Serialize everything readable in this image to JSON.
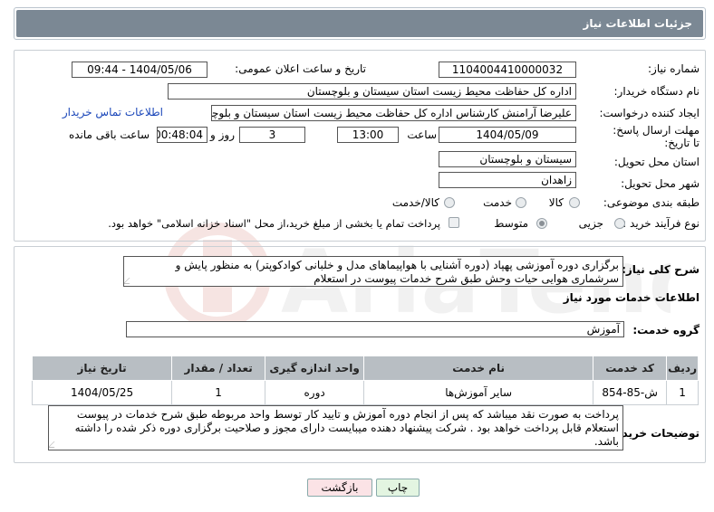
{
  "header": {
    "title": "جزئیات اطلاعات نیاز"
  },
  "fields": {
    "need_number_label": "شماره نیاز:",
    "need_number": "1104004410000032",
    "announce_label": "تاریخ و ساعت اعلان عمومی:",
    "announce_value": "1404/05/06 - 09:44",
    "buyer_org_label": "نام دستگاه خریدار:",
    "buyer_org": "اداره کل حفاظت محیط زیست استان سیستان و بلوچستان",
    "creator_label": "ایجاد کننده درخواست:",
    "creator": "علیرضا آرامنش کارشناس اداره کل حفاظت محیط زیست استان سیستان و بلوچستان",
    "contact_link": "اطلاعات تماس خریدار",
    "deadline_label": "مهلت ارسال پاسخ: تا تاریخ:",
    "deadline_date": "1404/05/09",
    "time_label": "ساعت",
    "deadline_time": "13:00",
    "days_value": "3",
    "days_label": "روز و",
    "remaining_time": "00:48:04",
    "remaining_label": "ساعت باقی مانده",
    "province_label": "استان محل تحویل:",
    "province": "سیستان و بلوچستان",
    "city_label": "شهر محل تحویل:",
    "city": "زاهدان",
    "category_label": "طبقه بندی موضوعی:",
    "category_options": [
      "کالا",
      "خدمت",
      "کالا/خدمت"
    ],
    "process_label": "نوع فرآیند خرید :",
    "process_options": [
      "جزیی",
      "متوسط"
    ],
    "payment_note": "پرداخت تمام یا بخشی از مبلغ خرید،از محل \"اسناد خزانه اسلامی\" خواهد بود."
  },
  "description": {
    "label": "شرح کلی نیاز:",
    "text": "برگزاری دوره آموزشی پهپاد (دوره آشنایی با هواپیماهای مدل و خلبانی کوادکوپتر) به منظور پایش و سرشماری هوایی حیات وحش طبق شرح خدمات پیوست در استعلام"
  },
  "services": {
    "section_title": "اطلاعات خدمات مورد نیاز",
    "group_label": "گروه خدمت:",
    "group_value": "آموزش",
    "columns": [
      "ردیف",
      "کد خدمت",
      "نام خدمت",
      "واحد اندازه گیری",
      "تعداد / مقدار",
      "تاریخ نیاز"
    ],
    "rows": [
      [
        "1",
        "ش-85-854",
        "سایر آموزش‌ها",
        "دوره",
        "1",
        "1404/05/25"
      ]
    ]
  },
  "notes": {
    "label": "توضیحات خریدار:",
    "text": "پرداخت به صورت نقد میباشد که پس از انجام دوره آموزش و تایید کار توسط واحد مربوطه طبق شرح خدمات در پیوست استعلام قابل پرداخت خواهد بود . شرکت پیشنهاد دهنده میبایست دارای مجوز و صلاحیت برگزاری دوره ذکر شده را داشته باشد."
  },
  "buttons": {
    "print": "چاپ",
    "back": "بازگشت"
  },
  "colors": {
    "header_bg": "#7b8894",
    "link": "#1a46b9",
    "back_btn_bg": "#fbe3e6",
    "print_btn_bg": "#e3f5e1"
  }
}
